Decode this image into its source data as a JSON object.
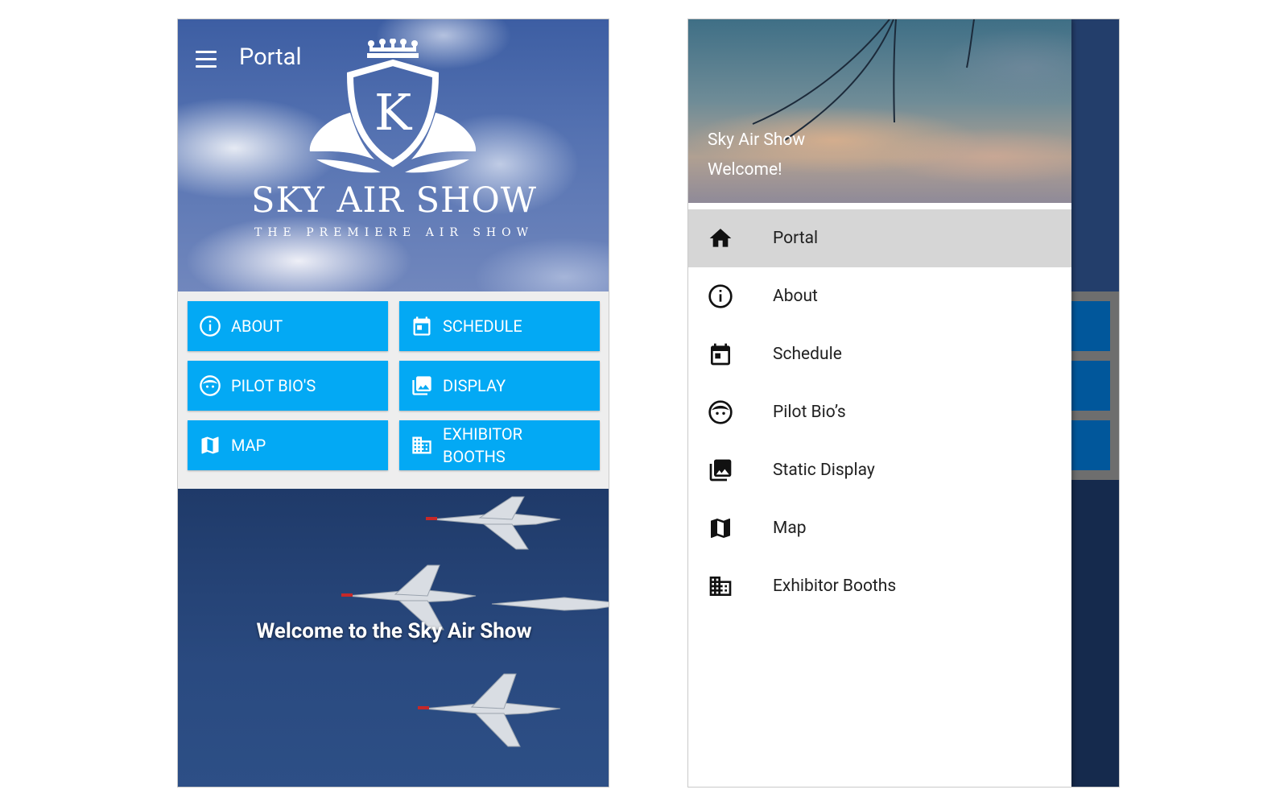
{
  "left_screen": {
    "toolbar": {
      "title": "Portal",
      "menu_icon": "hamburger-menu-icon"
    },
    "brand": {
      "logo_letter": "K",
      "name": "SKY AIR SHOW",
      "tagline": "THE PREMIERE AIR SHOW"
    },
    "tiles": [
      {
        "label": "ABOUT",
        "icon": "info-icon"
      },
      {
        "label": "SCHEDULE",
        "icon": "calendar-icon"
      },
      {
        "label": "PILOT BIO'S",
        "icon": "face-icon"
      },
      {
        "label": "DISPLAY",
        "icon": "photo-library-icon"
      },
      {
        "label": "MAP",
        "icon": "map-icon"
      },
      {
        "label": "EXHIBITOR\nBOOTHS",
        "icon": "building-icon"
      }
    ],
    "promo": {
      "text": "Welcome to the Sky Air Show"
    },
    "colors": {
      "tile": "#03a9f4",
      "promo_bg": "#1f3a69"
    }
  },
  "right_screen": {
    "drawer_header": {
      "title": "Sky Air Show",
      "subtitle": "Welcome!"
    },
    "nav_items": [
      {
        "label": "Portal",
        "icon": "home-icon",
        "active": true
      },
      {
        "label": "About",
        "icon": "info-icon",
        "active": false
      },
      {
        "label": "Schedule",
        "icon": "calendar-icon",
        "active": false
      },
      {
        "label": "Pilot Bio’s",
        "icon": "face-icon",
        "active": false
      },
      {
        "label": "Static Display",
        "icon": "photo-library-icon",
        "active": false
      },
      {
        "label": "Map",
        "icon": "map-icon",
        "active": false
      },
      {
        "label": "Exhibitor Booths",
        "icon": "building-icon",
        "active": false
      }
    ],
    "colors": {
      "active_item": "#d6d6d6",
      "scrim_tile": "#01579b"
    }
  }
}
